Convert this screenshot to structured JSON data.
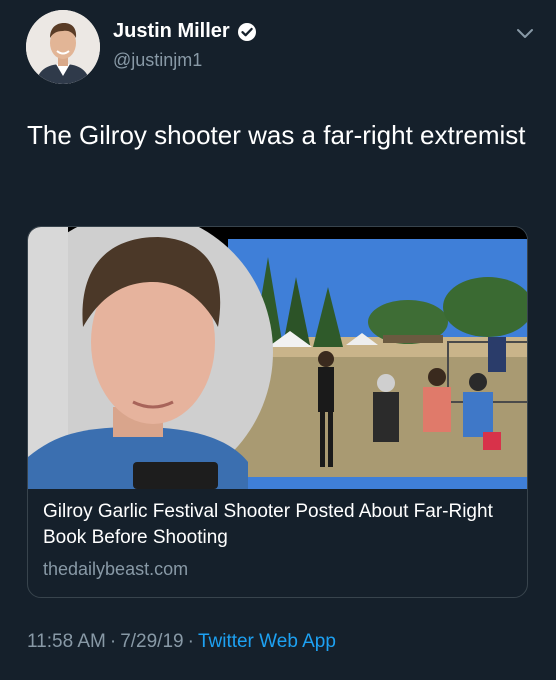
{
  "author": {
    "display_name": "Justin Miller",
    "handle": "@justinjm1",
    "verified": true
  },
  "tweet": {
    "text": "The Gilroy shooter was a far-right extremist"
  },
  "link_card": {
    "title": "Gilroy Garlic Festival Shooter Posted About Far-Right Book Before Shooting",
    "domain": "thedailybeast.com"
  },
  "meta": {
    "time": "11:58 AM",
    "separator": "·",
    "date": "7/29/19",
    "source": "Twitter Web App"
  },
  "icons": {
    "verified": "verified-badge-icon",
    "menu": "chevron-down-icon"
  },
  "colors": {
    "background": "#15202b",
    "secondary_text": "#8899a6",
    "link": "#1da1f2",
    "border": "#38444d"
  }
}
